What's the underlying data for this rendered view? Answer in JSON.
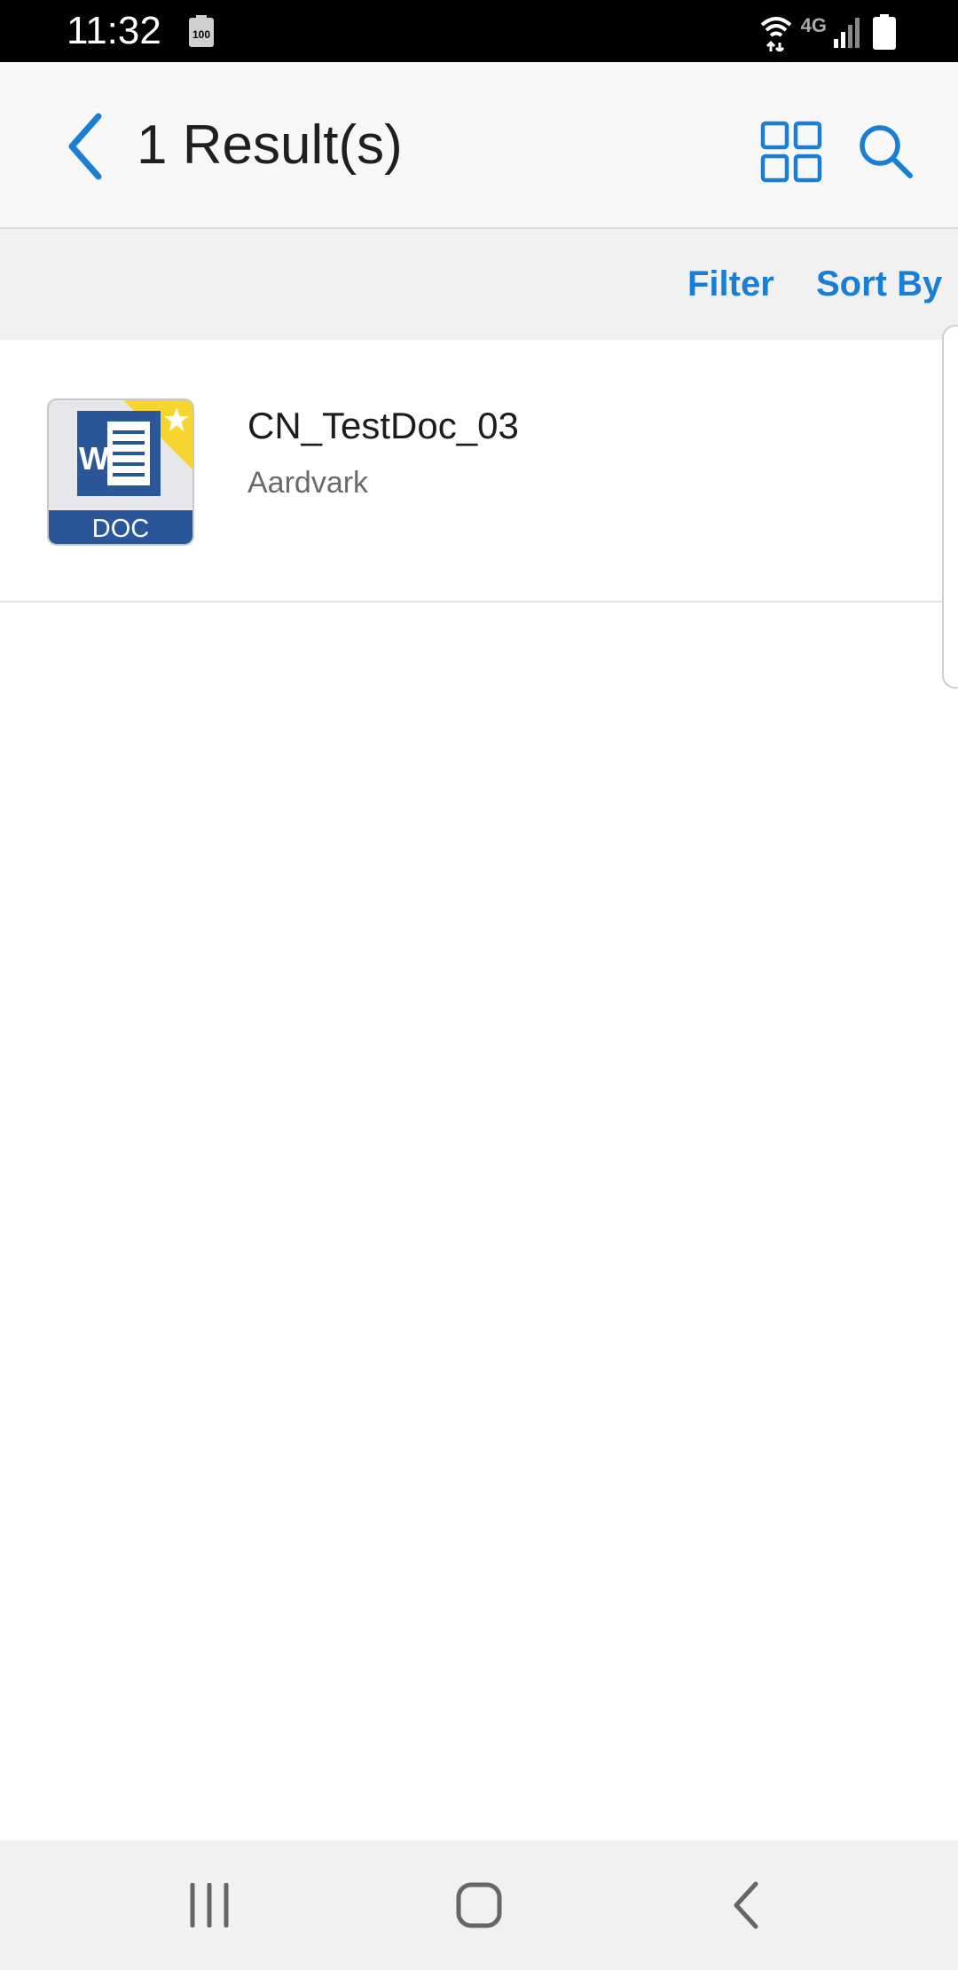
{
  "status_bar": {
    "time": "11:32",
    "battery_small_label": "100",
    "network_label": "4G",
    "icons": [
      "battery-small-icon",
      "wifi-icon",
      "lte-icon",
      "signal-icon",
      "battery-icon"
    ]
  },
  "app_bar": {
    "title": "1 Result(s)",
    "back_icon": "chevron-left-icon",
    "actions": [
      "grid-view-icon",
      "search-icon"
    ]
  },
  "filter_bar": {
    "filter_label": "Filter",
    "sort_label": "Sort By"
  },
  "results": [
    {
      "name": "CN_TestDoc_03",
      "subtitle": "Aardvark",
      "thumb_label": "DOC",
      "thumb_letter": "W",
      "starred": true
    }
  ],
  "nav_bar": {
    "icons": [
      "recents-icon",
      "home-icon",
      "back-icon"
    ]
  },
  "colors": {
    "accent": "#1a7fd4",
    "doc_blue": "#2b579a",
    "star_yellow": "#f7d531"
  }
}
